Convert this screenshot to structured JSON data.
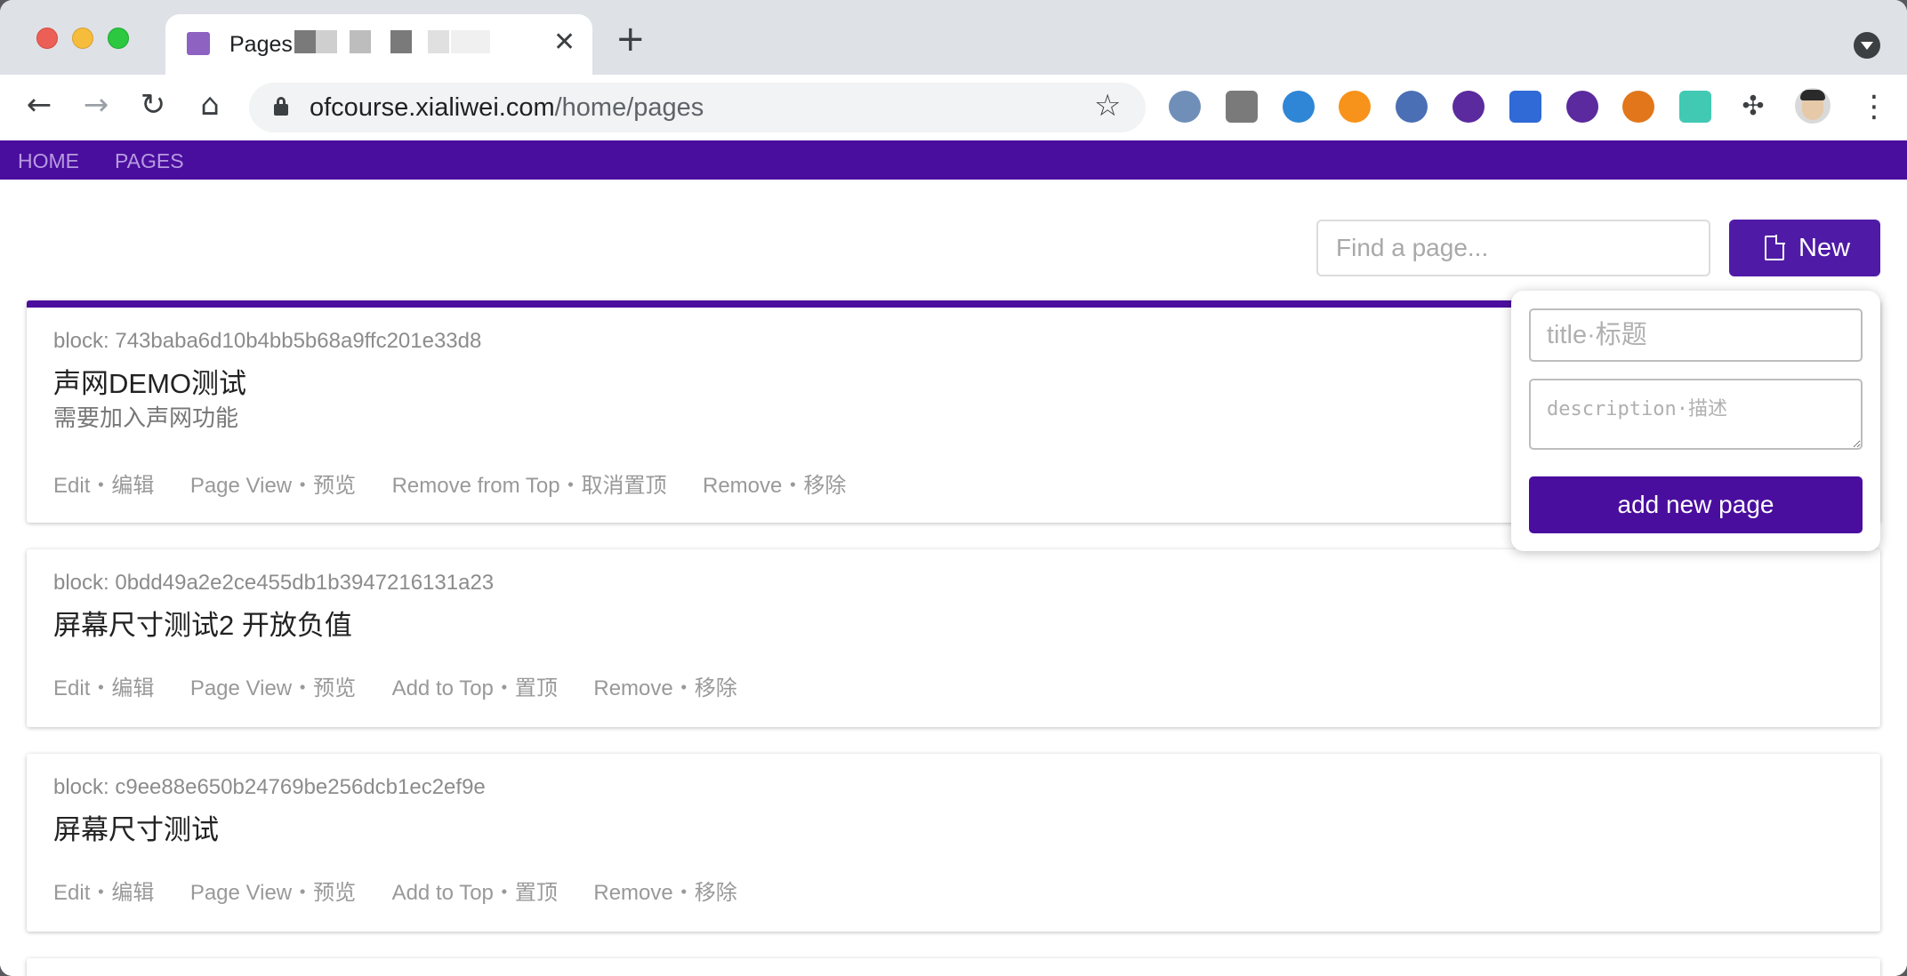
{
  "browser": {
    "tab_title": "Pages",
    "url_host": "ofcourse.xialiwei.com",
    "url_path": "/home/pages",
    "back_glyph": "←",
    "forward_glyph": "→",
    "reload_glyph": "↻",
    "home_glyph": "⌂",
    "star_glyph": "☆",
    "close_glyph": "✕",
    "newtab_glyph": "+",
    "puzzle_glyph": "✣",
    "kebab_glyph": "⋮",
    "extensions": [
      {
        "name": "sync-icon",
        "color": "#6f8fb8"
      },
      {
        "name": "screenshot-icon",
        "color": "#7a7a7a"
      },
      {
        "name": "globe-icon",
        "color": "#2f86d6"
      },
      {
        "name": "p-coin-icon",
        "color": "#f7931a"
      },
      {
        "name": "cloud-icon",
        "color": "#4a6fb5"
      },
      {
        "name": "bitcoin-icon",
        "color": "#5b2a9e"
      },
      {
        "name": "news-icon",
        "color": "#2f6ad6"
      },
      {
        "name": "bitcoin-icon",
        "color": "#5b2a9e"
      },
      {
        "name": "metamask-icon",
        "color": "#e2761b"
      },
      {
        "name": "line-icon",
        "color": "#41c9b4"
      }
    ]
  },
  "nav": {
    "home": "HOME",
    "pages": "PAGES"
  },
  "toolbar": {
    "search_placeholder": "Find a page...",
    "new_label": "New"
  },
  "popover": {
    "title_placeholder": "title·标题",
    "description_placeholder": "description·描述",
    "submit_label": "add new page"
  },
  "cards": [
    {
      "block": "block: 743baba6d10b4bb5b68a9ffc201e33d8",
      "title": "声网DEMO测试",
      "description": "需要加入声网功能",
      "pinned": true,
      "actions": {
        "edit": "Edit・编辑",
        "view": "Page View・预览",
        "top": "Remove from Top・取消置顶",
        "remove": "Remove・移除"
      }
    },
    {
      "block": "block: 0bdd49a2e2ce455db1b3947216131a23",
      "title": "屏幕尺寸测试2 开放负值",
      "description": "",
      "pinned": false,
      "actions": {
        "edit": "Edit・编辑",
        "view": "Page View・预览",
        "top": "Add to Top・置顶",
        "remove": "Remove・移除"
      }
    },
    {
      "block": "block: c9ee88e650b24769be256dcb1ec2ef9e",
      "title": "屏幕尺寸测试",
      "description": "",
      "pinned": false,
      "actions": {
        "edit": "Edit・编辑",
        "view": "Page View・预览",
        "top": "Add to Top・置顶",
        "remove": "Remove・移除"
      }
    }
  ],
  "colors": {
    "brand": "#4a0e9e",
    "button": "#4f1ba6"
  }
}
